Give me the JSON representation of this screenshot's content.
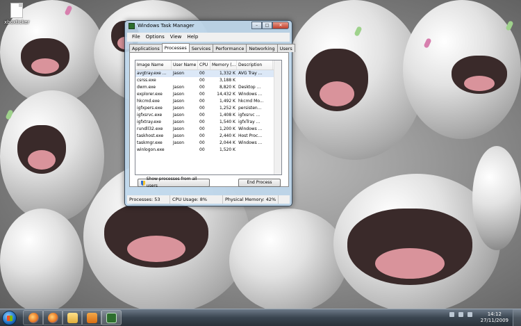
{
  "desktop": {
    "icon_label": "xboxticker"
  },
  "window": {
    "title": "Windows Task Manager",
    "controls": {
      "minimize": "–",
      "maximize": "□",
      "close": "✕"
    },
    "menu": [
      "File",
      "Options",
      "View",
      "Help"
    ],
    "tabs": [
      "Applications",
      "Processes",
      "Services",
      "Performance",
      "Networking",
      "Users"
    ],
    "active_tab": "Processes",
    "columns": [
      "Image Name",
      "User Name",
      "CPU",
      "Memory (...",
      "Description"
    ],
    "processes": [
      {
        "name": "avgtray.exe ...",
        "user": "Jason",
        "cpu": "00",
        "mem": "1,332 K",
        "desc": "AVG Tray ..."
      },
      {
        "name": "csrss.exe",
        "user": "",
        "cpu": "00",
        "mem": "3,188 K",
        "desc": ""
      },
      {
        "name": "dwm.exe",
        "user": "Jason",
        "cpu": "00",
        "mem": "8,820 K",
        "desc": "Desktop ..."
      },
      {
        "name": "explorer.exe",
        "user": "Jason",
        "cpu": "00",
        "mem": "14,432 K",
        "desc": "Windows ..."
      },
      {
        "name": "hkcmd.exe",
        "user": "Jason",
        "cpu": "00",
        "mem": "1,492 K",
        "desc": "hkcmd Mo..."
      },
      {
        "name": "igfxpers.exe",
        "user": "Jason",
        "cpu": "00",
        "mem": "1,252 K",
        "desc": "persisten..."
      },
      {
        "name": "igfxsrvc.exe",
        "user": "Jason",
        "cpu": "00",
        "mem": "1,408 K",
        "desc": "igfxsrvc ..."
      },
      {
        "name": "igfxtray.exe",
        "user": "Jason",
        "cpu": "00",
        "mem": "1,540 K",
        "desc": "igfxTray ..."
      },
      {
        "name": "rundll32.exe",
        "user": "Jason",
        "cpu": "00",
        "mem": "1,200 K",
        "desc": "Windows ..."
      },
      {
        "name": "taskhost.exe",
        "user": "Jason",
        "cpu": "00",
        "mem": "2,440 K",
        "desc": "Host Proc..."
      },
      {
        "name": "taskmgr.exe",
        "user": "Jason",
        "cpu": "00",
        "mem": "2,044 K",
        "desc": "Windows ..."
      },
      {
        "name": "winlogon.exe",
        "user": "",
        "cpu": "00",
        "mem": "1,520 K",
        "desc": ""
      }
    ],
    "show_all_button": "Show processes from all users",
    "end_process_button": "End Process",
    "status": {
      "processes": "Processes: 53",
      "cpu": "CPU Usage: 8%",
      "memory": "Physical Memory: 42%"
    }
  },
  "taskbar": {
    "apps": [
      {
        "icon": "internet-explorer-icon"
      },
      {
        "icon": "firefox-icon"
      },
      {
        "icon": "folder-icon"
      },
      {
        "icon": "media-player-icon"
      },
      {
        "icon": "task-manager-icon"
      }
    ],
    "clock_time": "14:12",
    "clock_date": "27/11/2009"
  }
}
